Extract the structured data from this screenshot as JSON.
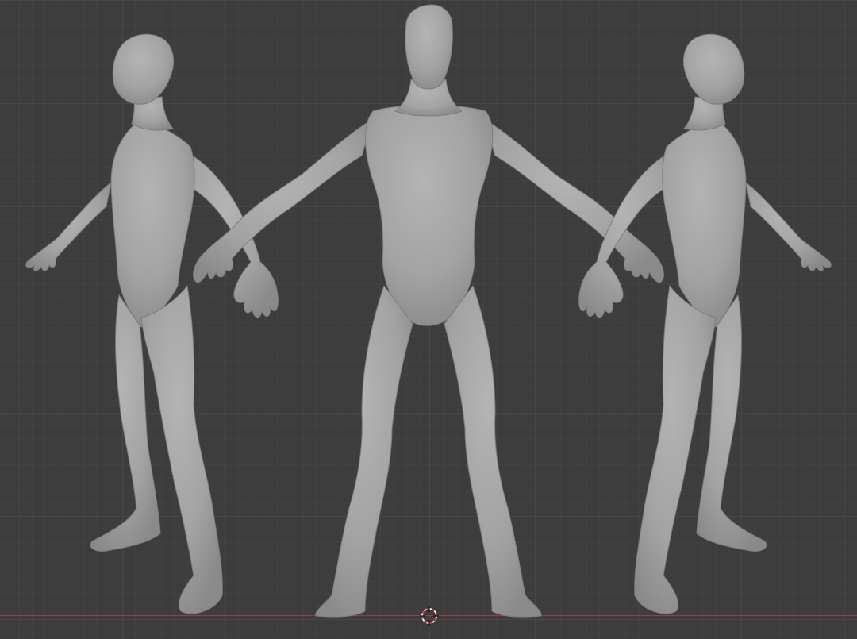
{
  "viewport": {
    "background": "#3d3d3d",
    "grid_color": "#474747",
    "x_axis_color": "#9a3b45",
    "mesh_color": "#a3a3a3"
  },
  "scene": {
    "figures": [
      "side-left-view",
      "front-view",
      "side-right-view"
    ],
    "cursor_icon": "3d-cursor-icon"
  }
}
